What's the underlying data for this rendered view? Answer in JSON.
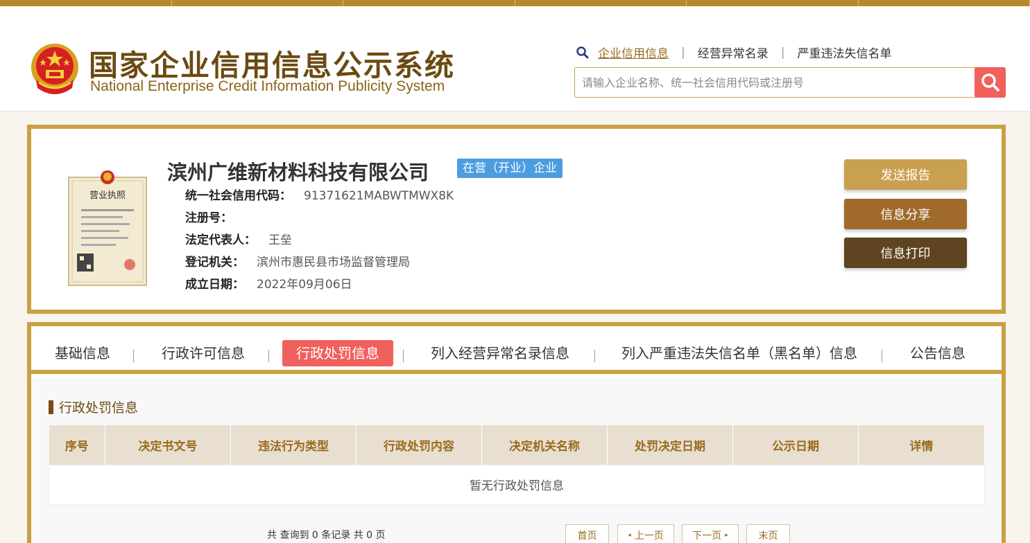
{
  "header": {
    "title_cn": "国家企业信用信息公示系统",
    "title_en": "National Enterprise Credit Information Publicity System",
    "quicklinks": [
      {
        "label": "企业信用信息",
        "active": true
      },
      {
        "label": "经营异常名录",
        "active": false
      },
      {
        "label": "严重违法失信名单",
        "active": false
      }
    ],
    "quicklink_separator": "|",
    "search": {
      "placeholder": "请输入企业名称、统一社会信用代码或注册号",
      "value": ""
    },
    "icons": {
      "emblem": "national-emblem-icon",
      "search": "search-icon"
    }
  },
  "company": {
    "name": "滨州广维新材料科技有限公司",
    "status": "在营（开业）企业",
    "fields": [
      {
        "label": "统一社会信用代码：",
        "value": "91371621MABWTMWX8K"
      },
      {
        "label": "注册号：",
        "value": ""
      },
      {
        "label": "法定代表人：",
        "value": "王垒"
      },
      {
        "label": "登记机关：",
        "value": "滨州市惠民县市场监督管理局"
      },
      {
        "label": "成立日期：",
        "value": "2022年09月06日"
      }
    ],
    "license_image": {
      "caption": "营业执照"
    },
    "actions": [
      {
        "label": "发送报告",
        "color": "#c9a050"
      },
      {
        "label": "信息分享",
        "color": "#a06a2a"
      },
      {
        "label": "信息打印",
        "color": "#5e4420"
      }
    ]
  },
  "tabs": [
    {
      "label": "基础信息",
      "active": false
    },
    {
      "label": "行政许可信息",
      "active": false
    },
    {
      "label": "行政处罚信息",
      "active": true
    },
    {
      "label": "列入经营异常名录信息",
      "active": false
    },
    {
      "label": "列入严重违法失信名单（黑名单）信息",
      "active": false
    },
    {
      "label": "公告信息",
      "active": false
    }
  ],
  "tab_separator": "|",
  "section": {
    "title": "行政处罚信息",
    "columns": [
      "序号",
      "决定书文号",
      "违法行为类型",
      "行政处罚内容",
      "决定机关名称",
      "处罚决定日期",
      "公示日期",
      "详情"
    ],
    "empty_text": "暂无行政处罚信息"
  },
  "pagination": {
    "summary": "共 查询到 0 条记录 共 0 页",
    "first": "首页",
    "prev": "上一页",
    "next": "下一页",
    "last": "末页"
  },
  "colors": {
    "gold": "#c9a043",
    "active_red": "#f0605d",
    "badge_blue": "#4c9ce0",
    "title_brown": "#6b4a12"
  }
}
